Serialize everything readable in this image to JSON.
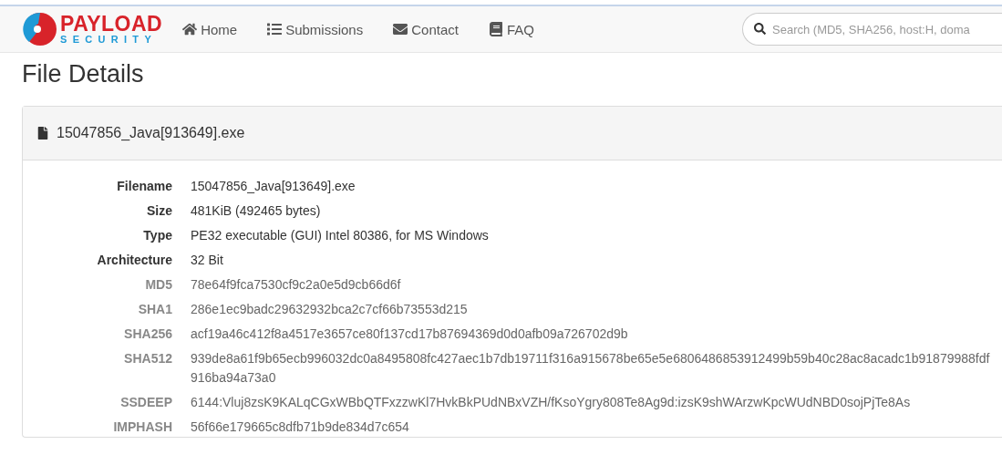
{
  "logo": {
    "line_1": "PAYLOAD",
    "line_2": "SECURITY"
  },
  "nav": [
    {
      "label": "Home",
      "kind": "home"
    },
    {
      "label": "Submissions",
      "kind": "list"
    },
    {
      "label": "Contact",
      "kind": "mail"
    },
    {
      "label": "FAQ",
      "kind": "book"
    }
  ],
  "search": {
    "placeholder": "Search (MD5, SHA256, host:H, doma"
  },
  "page_title": "File Details",
  "panel": {
    "title": "15047856_Java[913649].exe",
    "rows": [
      {
        "label": "Filename",
        "value": "15047856_Java[913649].exe",
        "kind": "primary"
      },
      {
        "label": "Size",
        "value": "481KiB (492465 bytes)",
        "kind": "primary"
      },
      {
        "label": "Type",
        "value": "PE32 executable (GUI) Intel 80386, for MS Windows",
        "kind": "primary"
      },
      {
        "label": "Architecture",
        "value": "32 Bit",
        "kind": "primary"
      },
      {
        "label": "MD5",
        "value": "78e64f9fca7530cf9c2a0e5d9cb66d6f",
        "kind": "hash"
      },
      {
        "label": "SHA1",
        "value": "286e1ec9badc29632932bca2c7cf66b73553d215",
        "kind": "hash"
      },
      {
        "label": "SHA256",
        "value": "acf19a46c412f8a4517e3657ce80f137cd17b87694369d0d0afb09a726702d9b",
        "kind": "hash"
      },
      {
        "label": "SHA512",
        "value": "939de8a61f9b65ecb996032dc0a8495808fc427aec1b7db19711f316a915678be65e5e6806486853912499b59b40c28ac8acadc1b91879988fdf916ba94a73a0",
        "kind": "hash"
      },
      {
        "label": "SSDEEP",
        "value": "6144:Vluj8zsK9KALqCGxWBbQTFxzzwKl7HvkBkPUdNBxVZH/fKsoYgry808Te8Ag9d:izsK9shWArzwKpcWUdNBD0sojPjTe8As",
        "kind": "hash"
      },
      {
        "label": "IMPHASH",
        "value": "56f66e179665c8dfb71b9de834d7c654",
        "kind": "hash"
      }
    ]
  }
}
